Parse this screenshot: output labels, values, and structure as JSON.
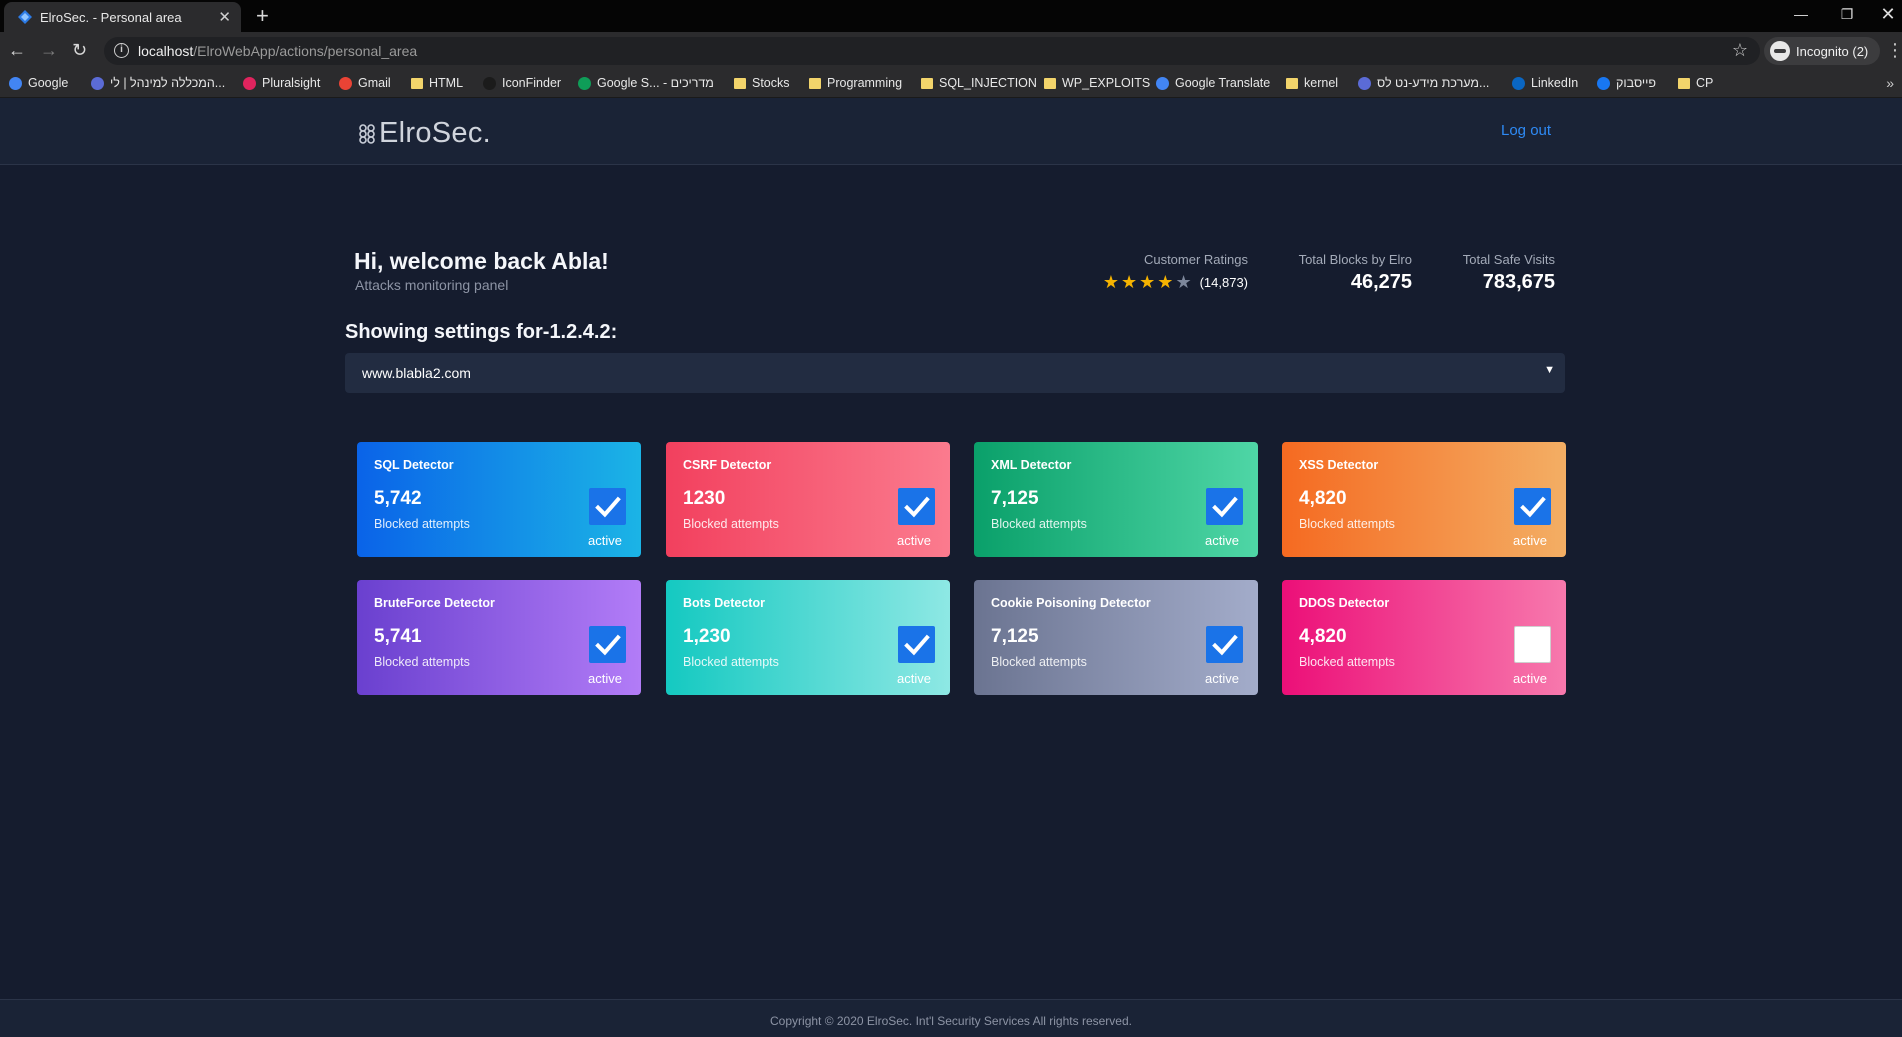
{
  "browser": {
    "tab_title": "ElroSec. - Personal area",
    "new_tab_icon": "plus-icon",
    "url_host": "localhost",
    "url_path": "/ElroWebApp/actions/personal_area",
    "profile_label": "Incognito (2)",
    "bookmarks": [
      {
        "label": "Google",
        "icon": "google-icon",
        "color": "#4285f4"
      },
      {
        "label": "המכללה למינהל | לי...",
        "icon": "college-icon",
        "color": "#5b6bd6"
      },
      {
        "label": "Pluralsight",
        "icon": "pluralsight-icon",
        "color": "#e0245e"
      },
      {
        "label": "Gmail",
        "icon": "gmail-icon",
        "color": "#ea4335"
      },
      {
        "label": "HTML",
        "icon": "folder-icon",
        "color": "#f2d46b"
      },
      {
        "label": "IconFinder",
        "icon": "iconfinder-icon",
        "color": "#1b1b1b"
      },
      {
        "label": "Google S... - מדריכים",
        "icon": "sheets-icon",
        "color": "#0f9d58"
      },
      {
        "label": "Stocks",
        "icon": "folder-icon",
        "color": "#f2d46b"
      },
      {
        "label": "Programming",
        "icon": "folder-icon",
        "color": "#f2d46b"
      },
      {
        "label": "SQL_INJECTION",
        "icon": "folder-icon",
        "color": "#f2d46b"
      },
      {
        "label": "WP_EXPLOITS",
        "icon": "folder-icon",
        "color": "#f2d46b"
      },
      {
        "label": "Google Translate",
        "icon": "translate-icon",
        "color": "#4285f4"
      },
      {
        "label": "kernel",
        "icon": "folder-icon",
        "color": "#f2d46b"
      },
      {
        "label": "מערכת מידע-נט לס...",
        "icon": "infonet-icon",
        "color": "#5b6bd6"
      },
      {
        "label": "LinkedIn",
        "icon": "linkedin-icon",
        "color": "#0a66c2"
      },
      {
        "label": "פייסבוק",
        "icon": "facebook-icon",
        "color": "#1877f2"
      },
      {
        "label": "CP",
        "icon": "folder-icon",
        "color": "#f2d46b"
      }
    ]
  },
  "header": {
    "logo_text": "ElroSec.",
    "logout_label": "Log out",
    "accent_color": "#2e8af5"
  },
  "welcome": {
    "greeting": "Hi, welcome back Abla!",
    "subtitle": "Attacks monitoring panel"
  },
  "stats": {
    "rating_label": "Customer Ratings",
    "rating_stars": 4,
    "rating_max": 5,
    "rating_count": "(14,873)",
    "blocks_label": "Total Blocks by Elro",
    "blocks_value": "46,275",
    "visits_label": "Total Safe Visits",
    "visits_value": "783,675"
  },
  "settings": {
    "heading_prefix": "Showing settings for-",
    "heading_ip": "1.2.4.2",
    "heading_suffix": ":",
    "selected_site": "www.blabla2.com"
  },
  "detectors": [
    {
      "title": "SQL Detector",
      "value": "5,742",
      "caption": "Blocked attempts",
      "status": "active",
      "checked": true,
      "gradient": [
        "#0a63e8",
        "#1bb4e6"
      ]
    },
    {
      "title": "CSRF Detector",
      "value": "1230",
      "caption": "Blocked attempts",
      "status": "active",
      "checked": true,
      "gradient": [
        "#f2405e",
        "#fb7b8e"
      ]
    },
    {
      "title": "XML Detector",
      "value": "7,125",
      "caption": "Blocked attempts",
      "status": "active",
      "checked": true,
      "gradient": [
        "#0aa06a",
        "#4fd6a6"
      ]
    },
    {
      "title": "XSS Detector",
      "value": "4,820",
      "caption": "Blocked attempts",
      "status": "active",
      "checked": true,
      "gradient": [
        "#f56a21",
        "#f3ae64"
      ]
    },
    {
      "title": "BruteForce Detector",
      "value": "5,741",
      "caption": "Blocked attempts",
      "status": "active",
      "checked": true,
      "gradient": [
        "#6a40cf",
        "#b27cf7"
      ]
    },
    {
      "title": "Bots Detector",
      "value": "1,230",
      "caption": "Blocked attempts",
      "status": "active",
      "checked": true,
      "gradient": [
        "#14c9c1",
        "#8ee8e4"
      ]
    },
    {
      "title": "Cookie Poisoning Detector",
      "value": "7,125",
      "caption": "Blocked attempts",
      "status": "active",
      "checked": true,
      "gradient": [
        "#6b7491",
        "#a3acca"
      ]
    },
    {
      "title": "DDOS Detector",
      "value": "4,820",
      "caption": "Blocked attempts",
      "status": "active",
      "checked": false,
      "gradient": [
        "#ec0f78",
        "#f779ad"
      ]
    }
  ],
  "footer": {
    "copyright": "Copyright © 2020 ElroSec. Int'l Security Services All rights reserved."
  }
}
